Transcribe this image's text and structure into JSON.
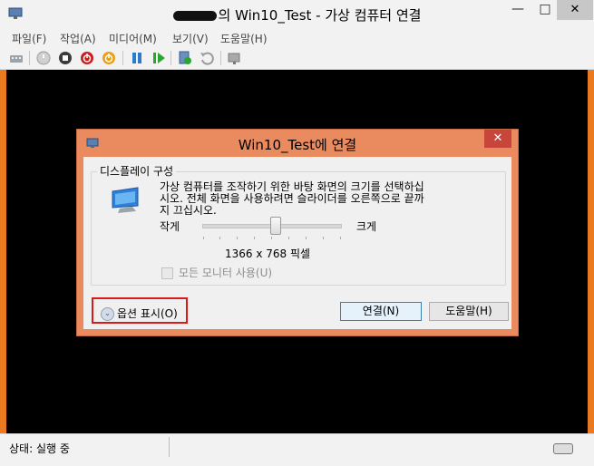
{
  "window": {
    "title": "의 Win10_Test - 가상 컴퓨터 연결"
  },
  "menu": [
    {
      "label": "파일(F)"
    },
    {
      "label": "작업(A)"
    },
    {
      "label": "미디어(M)"
    },
    {
      "label": "보기(V)"
    },
    {
      "label": "도움말(H)"
    }
  ],
  "toolbar": {
    "icons": [
      "ctrl-alt-del-icon",
      "start-icon",
      "turn-off-icon",
      "shutdown-icon",
      "save-icon",
      "pause-icon",
      "resume-icon",
      "checkpoint-icon",
      "revert-icon",
      "enhanced-session-icon"
    ]
  },
  "status": {
    "text": "상태: 실행 중"
  },
  "dialog": {
    "title": "Win10_Test에 연결",
    "group_title": "디스플레이 구성",
    "description": "가상 컴퓨터를 조작하기 위한 바탕 화면의 크기를 선택하십시오. 전체 화면을 사용하려면 슬라이더를 오른쪽으로 끝까지 끄십시오.",
    "small_label": "작게",
    "large_label": "크게",
    "resolution": "1366 x 768 픽셀",
    "slider_level": 0.54,
    "all_monitors_label": "모든 모니터 사용(U)",
    "all_monitors_checked": false,
    "options_label": "옵션 표시(O)",
    "connect_label": "연결(N)",
    "help_label": "도움말(H)"
  },
  "colors": {
    "window_frame": "#e97a1f",
    "dialog_frame": "#e98b5e",
    "highlight": "#d91a1a",
    "vm_screen": "#000000"
  }
}
